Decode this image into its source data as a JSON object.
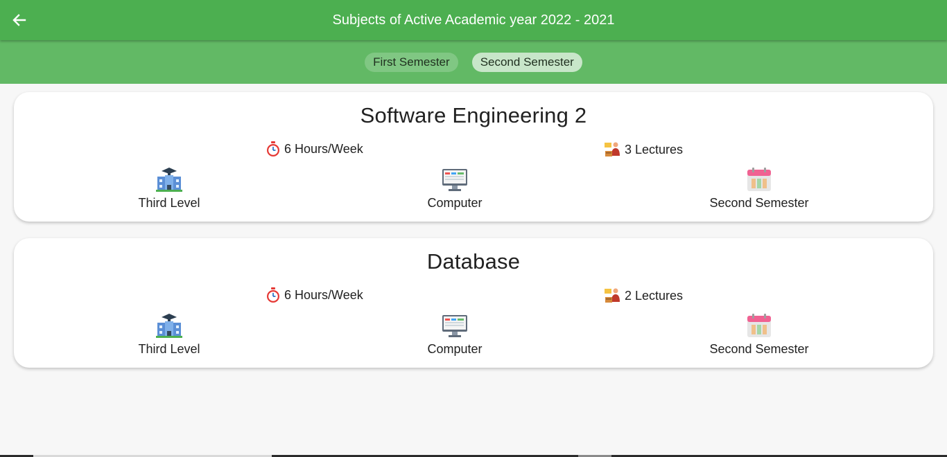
{
  "appbar": {
    "title": "Subjects of Active Academic year 2022 - 2021",
    "back_icon": "arrow-back-icon"
  },
  "tabs": [
    {
      "label": "First Semester",
      "selected": false
    },
    {
      "label": "Second Semester",
      "selected": true
    }
  ],
  "subjects": [
    {
      "name": "Software Engineering 2",
      "hours": "6 Hours/Week",
      "lectures": "3 Lectures",
      "level": "Third Level",
      "department": "Computer",
      "semester": "Second Semester"
    },
    {
      "name": "Database",
      "hours": "6 Hours/Week",
      "lectures": "2 Lectures",
      "level": "Third Level",
      "department": "Computer",
      "semester": "Second Semester"
    }
  ],
  "colors": {
    "appbar": "#4caf50",
    "tabbar": "#62b965",
    "chip_active": "#c8e6c9",
    "chip_inactive": "#80c783"
  }
}
